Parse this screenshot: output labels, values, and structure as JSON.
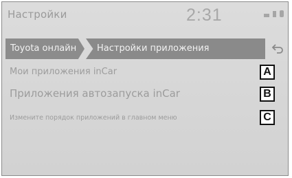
{
  "status": {
    "title": "Настройки",
    "time": "2:31"
  },
  "breadcrumb": {
    "items": [
      "Toyota онлайн",
      "Настройки приложения"
    ]
  },
  "back_icon": "back-arrow-icon",
  "menu": {
    "items": [
      {
        "label": "Мои приложения inCar",
        "callout": "A"
      },
      {
        "label": "Приложения автозапуска inCar",
        "callout": "B"
      },
      {
        "label": "Измените порядок приложений в главном меню",
        "callout": "C"
      }
    ]
  },
  "colors": {
    "screen_bg": "#d6d6d6",
    "breadcrumb_bg": "#8c8c8c",
    "text": "#9c9c9c"
  }
}
